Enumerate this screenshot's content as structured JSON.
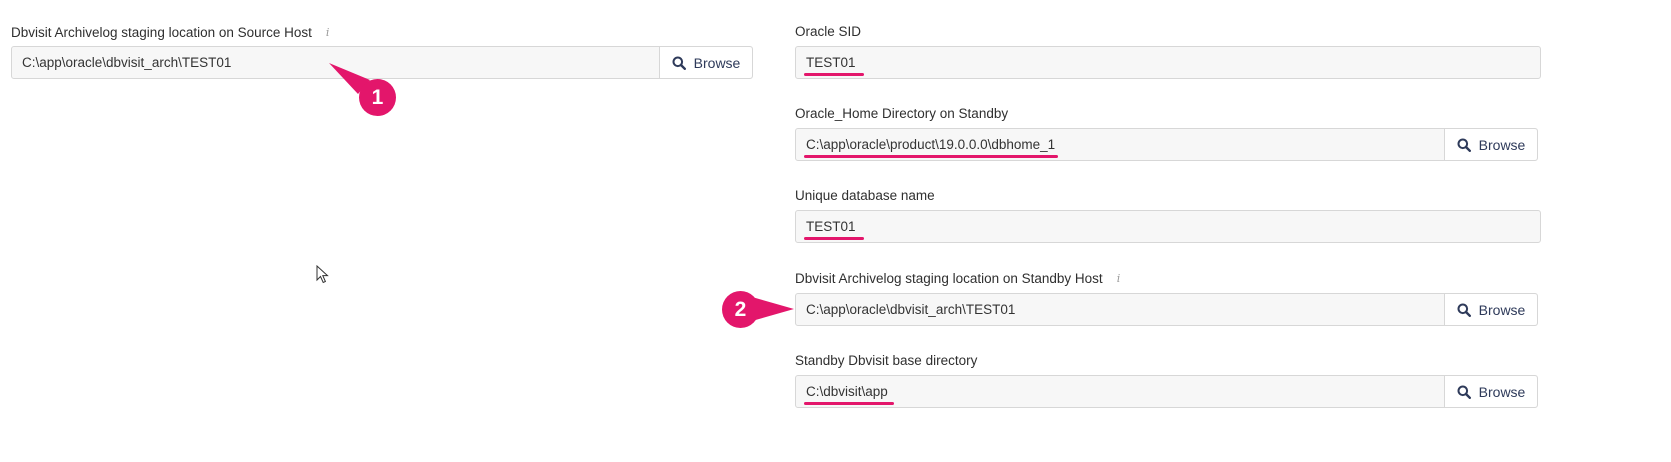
{
  "accent_color": "#e3166b",
  "browse_label": "Browse",
  "icons": {
    "browse": "search-icon",
    "info": "info-icon",
    "cursor": "mouse-pointer-icon"
  },
  "left": {
    "source_staging": {
      "label": "Dbvisit Archivelog staging location on Source Host",
      "value": "C:\\app\\oracle\\dbvisit_arch\\TEST01"
    }
  },
  "right": {
    "oracle_sid": {
      "label": "Oracle SID",
      "value": "TEST01"
    },
    "oracle_home": {
      "label": "Oracle_Home Directory on Standby",
      "value": "C:\\app\\oracle\\product\\19.0.0.0\\dbhome_1"
    },
    "unique_db_name": {
      "label": "Unique database name",
      "value": "TEST01"
    },
    "standby_staging": {
      "label": "Dbvisit Archivelog staging location on Standby Host",
      "value": "C:\\app\\oracle\\dbvisit_arch\\TEST01"
    },
    "standby_base_dir": {
      "label": "Standby Dbvisit base directory",
      "value": "C:\\dbvisit\\app"
    }
  },
  "annotations": {
    "badge1": "1",
    "badge2": "2"
  }
}
